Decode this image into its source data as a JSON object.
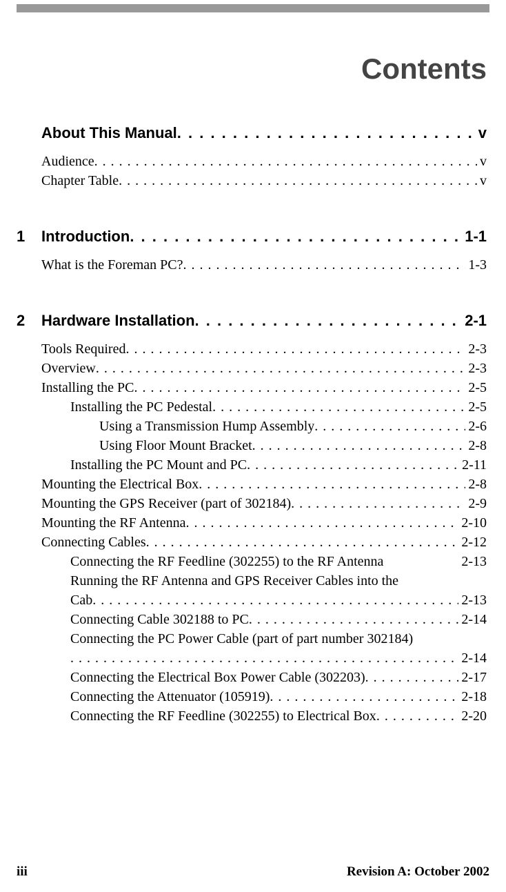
{
  "title": "Contents",
  "sections": [
    {
      "num": "",
      "heading": "About This Manual",
      "page": "v",
      "items": [
        {
          "level": 0,
          "label": "Audience",
          "page": "v",
          "dots": true
        },
        {
          "level": 0,
          "label": "Chapter Table",
          "page": "v",
          "dots": true
        }
      ]
    },
    {
      "num": "1",
      "heading": "Introduction",
      "page": "1-1",
      "items": [
        {
          "level": 0,
          "label": "What is the Foreman PC?",
          "page": "1-3",
          "dots": true
        }
      ]
    },
    {
      "num": "2",
      "heading": "Hardware Installation",
      "page": "2-1",
      "items": [
        {
          "level": 0,
          "label": "Tools Required",
          "page": "2-3",
          "dots": true
        },
        {
          "level": 0,
          "label": "Overview",
          "page": "2-3",
          "dots": true
        },
        {
          "level": 0,
          "label": "Installing the PC",
          "page": "2-5",
          "dots": true
        },
        {
          "level": 1,
          "label": "Installing the PC Pedestal",
          "page": "2-5",
          "dots": true
        },
        {
          "level": 2,
          "label": "Using a Transmission Hump Assembly",
          "page": "2-6",
          "dots": true
        },
        {
          "level": 2,
          "label": "Using Floor Mount Bracket",
          "page": "2-8",
          "dots": true
        },
        {
          "level": 1,
          "label": "Installing the PC Mount and PC",
          "page": "2-11",
          "dots": true
        },
        {
          "level": 0,
          "label": "Mounting the Electrical Box",
          "page": "2-8",
          "dots": true
        },
        {
          "level": 0,
          "label": "Mounting the GPS Receiver (part of 302184)",
          "page": "2-9",
          "dots": true
        },
        {
          "level": 0,
          "label": "Mounting the RF Antenna",
          "page": "2-10",
          "dots": true
        },
        {
          "level": 0,
          "label": "Connecting Cables",
          "page": "2-12",
          "dots": true
        },
        {
          "level": 1,
          "label": "Connecting the RF Feedline (302255) to the RF Antenna",
          "page": "2-13",
          "dots": false
        },
        {
          "level": 1,
          "label": "Running the RF Antenna and GPS Receiver Cables into the",
          "page": "",
          "dots": false,
          "wrap": true
        },
        {
          "level": 1,
          "label": "Cab",
          "page": "2-13",
          "dots": true
        },
        {
          "level": 1,
          "label": "Connecting Cable 302188 to PC",
          "page": "2-14",
          "dots": true
        },
        {
          "level": 1,
          "label": "Connecting the PC Power Cable (part of part number 302184)",
          "page": "",
          "dots": false,
          "wrap": true
        },
        {
          "level": 1,
          "label": "",
          "page": "2-14",
          "dots": true
        },
        {
          "level": 1,
          "label": "Connecting the Electrical Box Power Cable (302203)",
          "page": "2-17",
          "dots": true
        },
        {
          "level": 1,
          "label": "Connecting the Attenuator (105919)",
          "page": "2-18",
          "dots": true
        },
        {
          "level": 1,
          "label": "Connecting the RF Feedline (302255) to Electrical Box",
          "page": "2-20",
          "dots": true
        }
      ]
    }
  ],
  "footer": {
    "left": "iii",
    "right": "Revision A: October 2002"
  }
}
